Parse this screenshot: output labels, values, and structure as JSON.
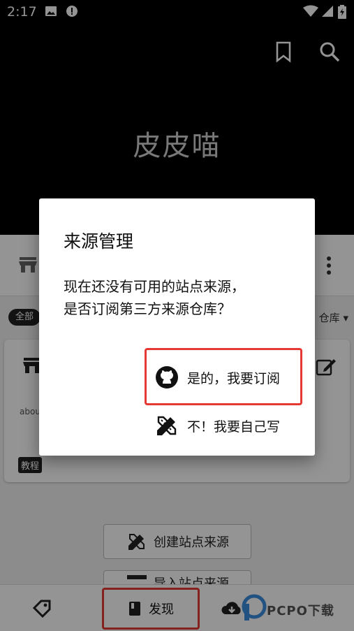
{
  "status_bar": {
    "time": "2:17"
  },
  "header": {
    "app_title": "皮皮喵"
  },
  "background": {
    "chip_all": "全部",
    "repo_label": "仓库",
    "card_about": "abou",
    "card_tag": "教程",
    "create_source_label": "创建站点来源",
    "import_source_label": "导入站点来源"
  },
  "bottom_nav": {
    "discover_label": "发现"
  },
  "dialog": {
    "title": "来源管理",
    "message_line1": "现在还没有可用的站点来源，",
    "message_line2": "是否订阅第三方来源仓库？",
    "subscribe_label": "是的，我要订阅",
    "self_write_label": "不！我要自己写"
  },
  "watermark": {
    "text": "PCPO下载"
  },
  "colors": {
    "highlight": "#e53935",
    "header_bg": "#000000",
    "title_gray": "#cfcfcf"
  }
}
